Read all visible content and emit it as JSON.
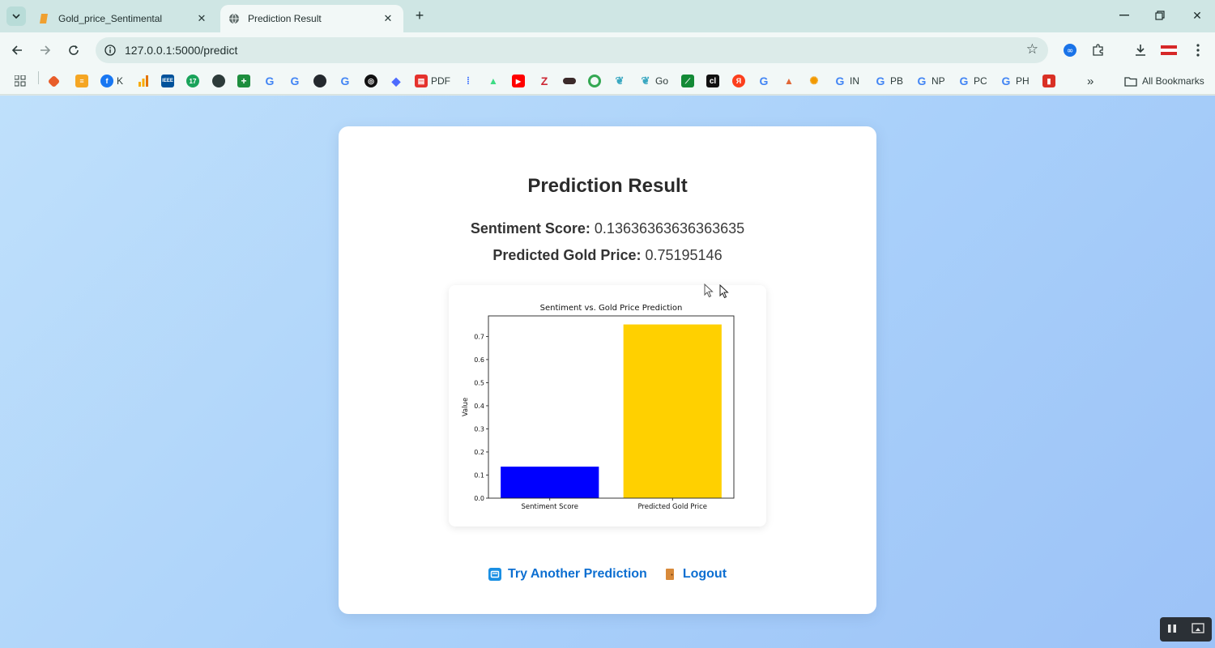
{
  "browser": {
    "tabs": [
      {
        "label": "Gold_price_Sentimental",
        "active": false
      },
      {
        "label": "Prediction Result",
        "active": true
      }
    ],
    "url": "127.0.0.1:5000/predict",
    "bookmarks": [
      {
        "icon": "k-facebook",
        "label": "K"
      },
      {
        "icon": "pdf-icon",
        "label": "PDF"
      },
      {
        "icon": "go-icon",
        "label": "Go"
      },
      {
        "icon": "google-icon",
        "label": "IN"
      },
      {
        "icon": "google-icon",
        "label": "PB"
      },
      {
        "icon": "google-icon",
        "label": "NP"
      },
      {
        "icon": "google-icon",
        "label": "PC"
      },
      {
        "icon": "google-icon",
        "label": "PH"
      }
    ],
    "all_bookmarks_label": "All Bookmarks",
    "overflow_label": "»"
  },
  "page": {
    "title": "Prediction Result",
    "sentiment_label": "Sentiment Score:",
    "sentiment_value": "0.13636363636363635",
    "gold_label": "Predicted Gold Price:",
    "gold_value": "0.75195146",
    "links": {
      "try_again": "Try Another Prediction",
      "logout": "Logout"
    }
  },
  "chart_data": {
    "type": "bar",
    "title": "Sentiment vs. Gold Price Prediction",
    "xlabel": "",
    "ylabel": "Value",
    "categories": [
      "Sentiment Score",
      "Predicted Gold Price"
    ],
    "values": [
      0.13636363636363635,
      0.75195146
    ],
    "colors": [
      "#0000ff",
      "#ffd000"
    ],
    "ylim": [
      0,
      0.789
    ],
    "yticks": [
      "0.0",
      "0.1",
      "0.2",
      "0.3",
      "0.4",
      "0.5",
      "0.6",
      "0.7"
    ],
    "grid": false,
    "legend": "none"
  },
  "colors": {
    "accent": "#0d6fd1",
    "page_bg_start": "#bfe0fb",
    "page_bg_end": "#9cc2f7"
  }
}
